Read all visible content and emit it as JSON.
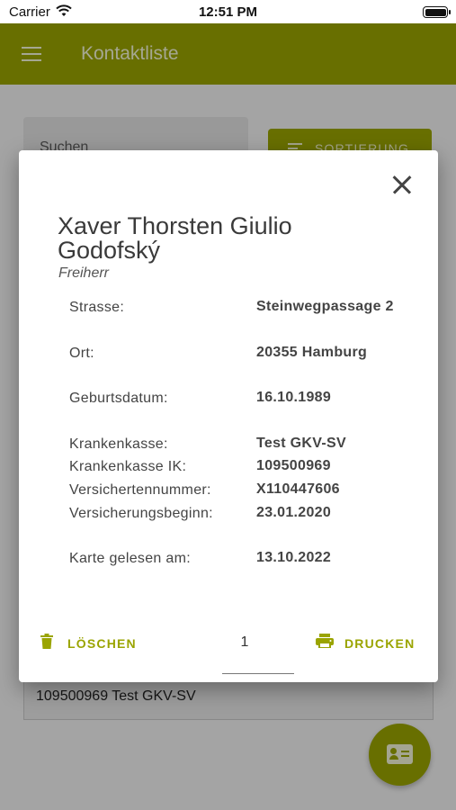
{
  "status_bar": {
    "carrier": "Carrier",
    "time": "12:51 PM"
  },
  "app_bar": {
    "title": "Kontaktliste"
  },
  "background": {
    "search_placeholder": "Suchen",
    "sort_button": "SORTIERUNG",
    "list_item": "109500969 Test GKV-SV"
  },
  "dialog": {
    "name": "Xaver Thorsten Giulio Godofský",
    "title": "Freiherr",
    "fields": [
      {
        "label": "Strasse:",
        "value": "Steinwegpassage 2"
      },
      {
        "label": "Ort:",
        "value": "20355 Hamburg"
      },
      {
        "label": "Geburtsdatum:",
        "value": "16.10.1989"
      },
      {
        "label": "Krankenkasse:",
        "value": "Test GKV-SV"
      },
      {
        "label": "Krankenkasse IK:",
        "value": "109500969"
      },
      {
        "label": "Versichertennummer:",
        "value": "X110447606"
      },
      {
        "label": "Versicherungsbeginn:",
        "value": "23.01.2020"
      },
      {
        "label": "Karte gelesen am:",
        "value": "13.10.2022"
      }
    ],
    "delete_button": "LÖSCHEN",
    "print_button": "DRUCKEN",
    "copies": "1"
  },
  "colors": {
    "accent": "#9aa400",
    "appbar_text": "#f4f6d8"
  },
  "icons": [
    "wifi-icon",
    "battery-icon",
    "menu-icon",
    "sort-icon",
    "close-icon",
    "trash-icon",
    "printer-icon",
    "contact-card-icon"
  ]
}
